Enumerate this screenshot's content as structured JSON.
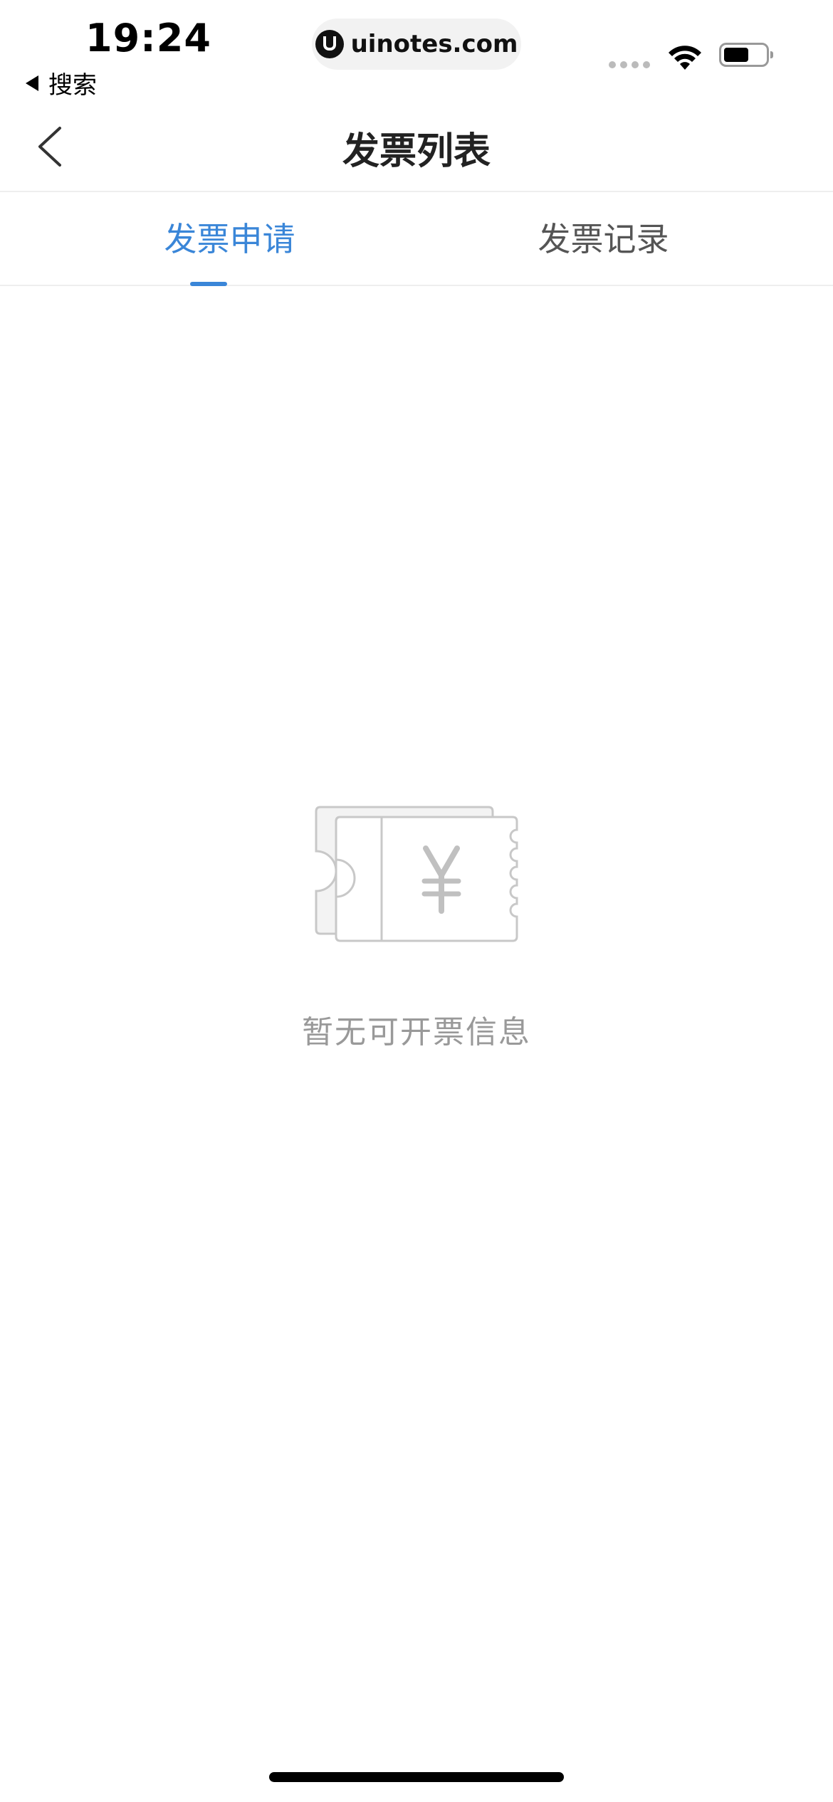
{
  "status_bar": {
    "time": "19:24",
    "back_label": "搜索",
    "url": "uinotes.com"
  },
  "nav": {
    "title": "发票列表"
  },
  "tabs": [
    {
      "label": "发票申请",
      "active": true
    },
    {
      "label": "发票记录",
      "active": false
    }
  ],
  "empty_state": {
    "icon": "invoice-ticket-icon",
    "message": "暂无可开票信息"
  },
  "colors": {
    "accent": "#3a86d8",
    "text_primary": "#222222",
    "text_secondary": "#555555",
    "text_muted": "#999999",
    "divider": "#eeeeee"
  }
}
